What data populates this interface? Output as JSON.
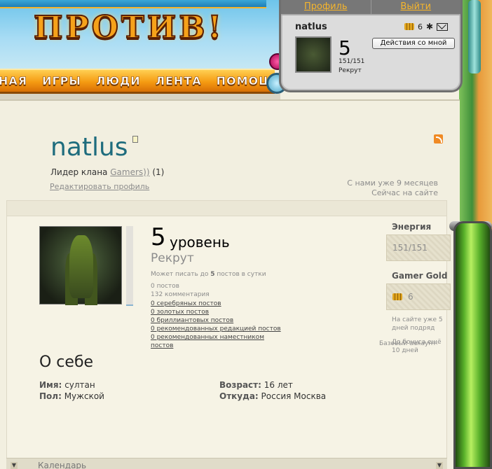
{
  "header": {
    "logo_word": "ПРОТИВ!",
    "nav_items": [
      "НАЯ",
      "ИГРЫ",
      "ЛЮДИ",
      "ЛЕНТА",
      "ПОМОЩЬ"
    ]
  },
  "user_panel": {
    "links": [
      "Профиль",
      "Выйти"
    ],
    "username": "natlus",
    "gold": "6",
    "level": "5",
    "energy": "151/151",
    "rank": "Рекрут",
    "actions_button": "Действия со мной"
  },
  "profile": {
    "name": "natlus",
    "clan_prefix": "Лидер клана",
    "clan_link": "Gamers))",
    "clan_count": "(1)",
    "edit_link": "Редактировать профиль",
    "since": "С нами уже 9 месяцев",
    "online": "Сейчас на сайте",
    "level": "5",
    "level_word": "уровень",
    "rank": "Рекрут",
    "posts_limit_pre": "Может писать до",
    "posts_limit_num": "5",
    "posts_limit_post": "постов в сутки",
    "stats": [
      "0 постов",
      "132 комментария"
    ],
    "stat_links": [
      "0 серебряных постов",
      "0 золотых постов",
      "0 бриллиантовых постов",
      "0 рекомендованных редакцией постов",
      "0 рекомендованных наместником постов"
    ]
  },
  "about": {
    "title": "О себе",
    "name_label": "Имя:",
    "name_value": "султан",
    "gender_label": "Пол:",
    "gender_value": "Мужской",
    "age_label": "Возраст:",
    "age_value": "16 лет",
    "from_label": "Откуда:",
    "from_value": "Россия Москва"
  },
  "sidebar": {
    "energy_title": "Энергия",
    "energy_value": "151/151",
    "gold_title": "Gamer Gold",
    "gold_value": "6",
    "streak_note": "На сайте уже 5 дней подряд",
    "bonus_note": "До бонуса ещё 10 дней"
  },
  "footer": {
    "base_account": "Базовый аккаунт",
    "calendar": "Календарь"
  }
}
